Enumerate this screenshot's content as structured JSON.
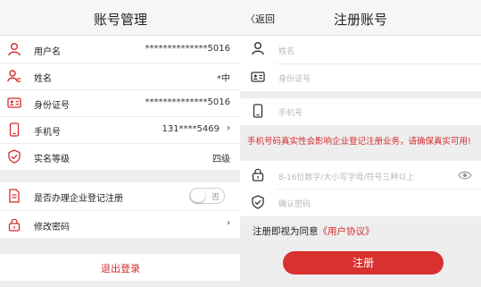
{
  "colors": {
    "accent": "#d42b2b",
    "button": "#d93030",
    "background": "#eeeeee"
  },
  "left": {
    "title": "账号管理",
    "rows": [
      {
        "label": "用户名",
        "value": "**************5016",
        "icon": "user-icon"
      },
      {
        "label": "姓名",
        "value": "*中",
        "icon": "person-tag-icon"
      },
      {
        "label": "身份证号",
        "value": "**************5016",
        "icon": "id-card-icon"
      },
      {
        "label": "手机号",
        "value": "131****5469",
        "icon": "phone-icon"
      },
      {
        "label": "实名等级",
        "value": "四级",
        "icon": "shield-check-icon"
      }
    ],
    "enterprise": {
      "label": "是否办理企业登记注册",
      "toggle_label": "否",
      "icon": "document-icon"
    },
    "password": {
      "label": "修改密码",
      "icon": "lock-icon"
    },
    "logout": "退出登录"
  },
  "right": {
    "back": "返回",
    "title": "注册账号",
    "fields": {
      "name_placeholder": "姓名",
      "id_placeholder": "身份证号",
      "phone_placeholder": "手机号",
      "password_placeholder": "8-16位数字/大小写字母/符号三种以上",
      "confirm_placeholder": "确认密码"
    },
    "warning": "手机号码真实性会影响企业登记注册业务，请确保真实可用!",
    "agree_prefix": "注册即视为同意",
    "agree_link": "《用户协议》",
    "submit": "注册"
  }
}
